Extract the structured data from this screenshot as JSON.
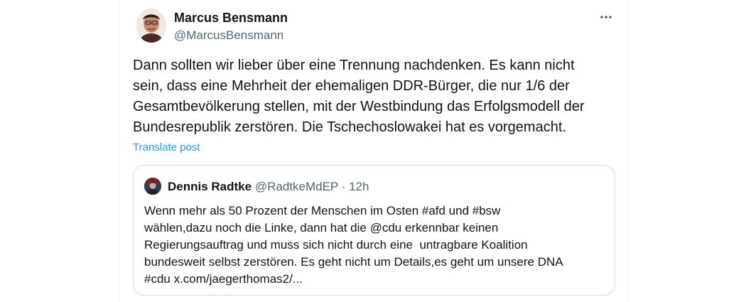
{
  "author": {
    "name": "Marcus Bensmann",
    "handle": "@MarcusBensmann"
  },
  "tweet": {
    "lines": [
      "Dann sollten wir lieber über eine Trennung nachdenken. Es kann nicht",
      "sein, dass eine Mehrheit der ehemaligen DDR-Bürger, die nur 1/6 der",
      "Gesamtbevölkerung stellen, mit der Westbindung das Erfolgsmodell der",
      "Bundesrepublik zerstören. Die Tschechoslowakei hat es vorgemacht."
    ],
    "translate_label": "Translate post"
  },
  "quote": {
    "name": "Dennis Radtke",
    "handle": "@RadtkeMdEP",
    "separator": "·",
    "time": "12h",
    "lines": [
      "Wenn mehr als 50 Prozent der Menschen im Osten #afd und #bsw",
      "wählen,dazu noch die Linke, dann hat die @cdu erkennbar keinen",
      "Regierungsauftrag und muss sich nicht durch eine  untragbare Koalition",
      "bundesweit selbst zerstören. Es geht nicht um Details,es geht um unsere DNA",
      "#cdu x.com/jaegerthomas2/..."
    ]
  },
  "icons": {
    "more": "more-horizontal-icon"
  },
  "colors": {
    "link": "#1d9bf0",
    "text": "#0f1419",
    "secondary": "#536471",
    "border": "#cfd9de"
  }
}
